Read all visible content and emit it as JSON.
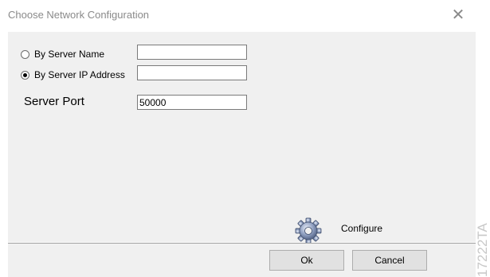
{
  "window": {
    "title": "Choose Network Configuration",
    "close_icon": "close-icon"
  },
  "form": {
    "by_server_name": {
      "label": "By Server Name",
      "selected": false,
      "value": ""
    },
    "by_server_ip": {
      "label": "By Server IP Address",
      "selected": true,
      "value": ""
    },
    "server_port": {
      "label": "Server Port",
      "value": "50000"
    }
  },
  "configure": {
    "icon": "gear-icon",
    "label": "Configure"
  },
  "buttons": {
    "ok_label": "Ok",
    "cancel_label": "Cancel"
  },
  "stamp": {
    "text": "17222TA"
  },
  "colors": {
    "client_background": "#f0f0f0",
    "title_text": "#8a8a8a",
    "button_face": "#e1e1e1"
  }
}
